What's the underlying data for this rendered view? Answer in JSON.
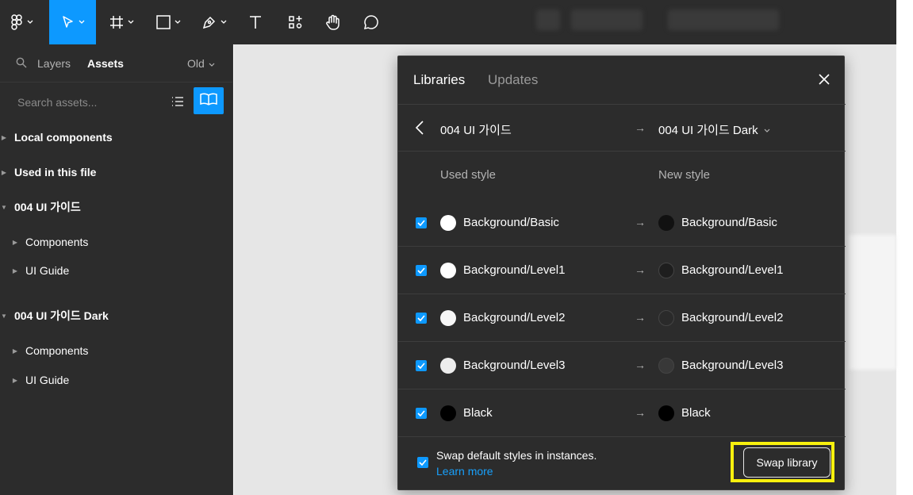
{
  "left_panel": {
    "tabs": [
      {
        "label": "Layers"
      },
      {
        "label": "Assets"
      }
    ],
    "version_selector": "Old",
    "search_placeholder": "Search assets...",
    "tree": [
      {
        "label": "Local components",
        "expanded": false
      },
      {
        "label": "Used in this file",
        "expanded": false
      },
      {
        "label": "004 UI 가이드",
        "expanded": true
      },
      {
        "label": "Components",
        "expanded": false
      },
      {
        "label": "UI Guide",
        "expanded": false
      },
      {
        "label": "004 UI 가이드 Dark",
        "expanded": true
      },
      {
        "label": "Components",
        "expanded": false
      },
      {
        "label": "UI Guide",
        "expanded": false
      }
    ]
  },
  "dialog": {
    "tabs": [
      {
        "label": "Libraries"
      },
      {
        "label": "Updates"
      }
    ],
    "source_library": "004 UI 가이드",
    "target_library": "004 UI 가이드 Dark",
    "col_used": "Used style",
    "col_new": "New style",
    "styles": [
      {
        "used": "Background/Basic",
        "new": "Background/Basic",
        "checked": true,
        "used_color": "#ffffff",
        "new_color": "#111111"
      },
      {
        "used": "Background/Level1",
        "new": "Background/Level1",
        "checked": true,
        "used_color": "#ffffff",
        "new_color": "#1e1e1e"
      },
      {
        "used": "Background/Level2",
        "new": "Background/Level2",
        "checked": true,
        "used_color": "#f7f7f7",
        "new_color": "#2a2a2a"
      },
      {
        "used": "Background/Level3",
        "new": "Background/Level3",
        "checked": true,
        "used_color": "#ededed",
        "new_color": "#383838"
      },
      {
        "used": "Black",
        "new": "Black",
        "checked": true,
        "used_color": "#000000",
        "new_color": "#000000"
      }
    ],
    "footer": {
      "checkbox_label": "Swap default styles in instances.",
      "checked": true,
      "learn_more": "Learn more",
      "swap_button": "Swap library"
    }
  },
  "colors": {
    "accent": "#0d99ff",
    "highlight": "#f8f00e",
    "link": "#18a0fb"
  }
}
